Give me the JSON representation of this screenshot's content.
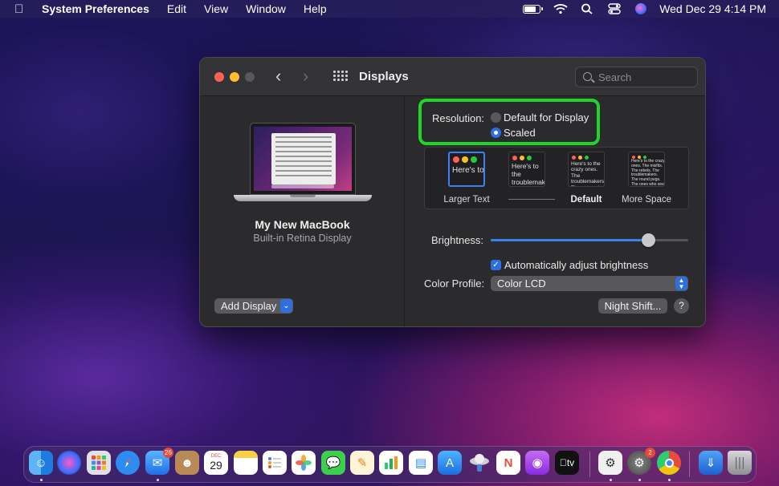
{
  "menubar": {
    "app_name": "System Preferences",
    "menus": [
      "Edit",
      "View",
      "Window",
      "Help"
    ],
    "clock": "Wed Dec 29  4:14 PM",
    "battery_level": 0.85
  },
  "window": {
    "title": "Displays",
    "search_placeholder": "Search"
  },
  "left": {
    "display_name": "My New MacBook",
    "display_subtitle": "Built-in Retina Display",
    "add_display_label": "Add Display"
  },
  "resolution": {
    "label": "Resolution:",
    "options": [
      "Default for Display",
      "Scaled"
    ],
    "selected": "Scaled"
  },
  "scaled_options": [
    {
      "label": "Larger Text",
      "preview": "Here's to the troublemakers",
      "selected": true
    },
    {
      "label": "",
      "preview": "Here's to the troublemakers. The ones who",
      "selected": false
    },
    {
      "label": "Default",
      "preview": "Here's to the crazy ones. The troublemakers. The ones who see things differently. They're not fond of rules. And they",
      "selected": false
    },
    {
      "label": "More Space",
      "preview": "Here's to the crazy ones. The misfits. The rebels. The troublemakers. The round pegs. The ones who see things differently. They're not fond of rules. And they have no respect for the status quo. You can quote them, disagree with them. About the only thing you can't do is ignore them.",
      "selected": false
    }
  ],
  "brightness": {
    "label": "Brightness:",
    "value": 0.82,
    "auto_label": "Automatically adjust brightness",
    "auto_checked": true
  },
  "color_profile": {
    "label": "Color Profile:",
    "value": "Color LCD"
  },
  "buttons": {
    "night_shift": "Night Shift...",
    "help": "?"
  },
  "dock": {
    "mail_badge": "26",
    "calendar_month": "DEC",
    "calendar_day": "29",
    "sysprefs_badge": "2",
    "tv_label": "tv"
  },
  "colors": {
    "accent": "#2b6fe0",
    "highlight": "#1fd42b"
  }
}
